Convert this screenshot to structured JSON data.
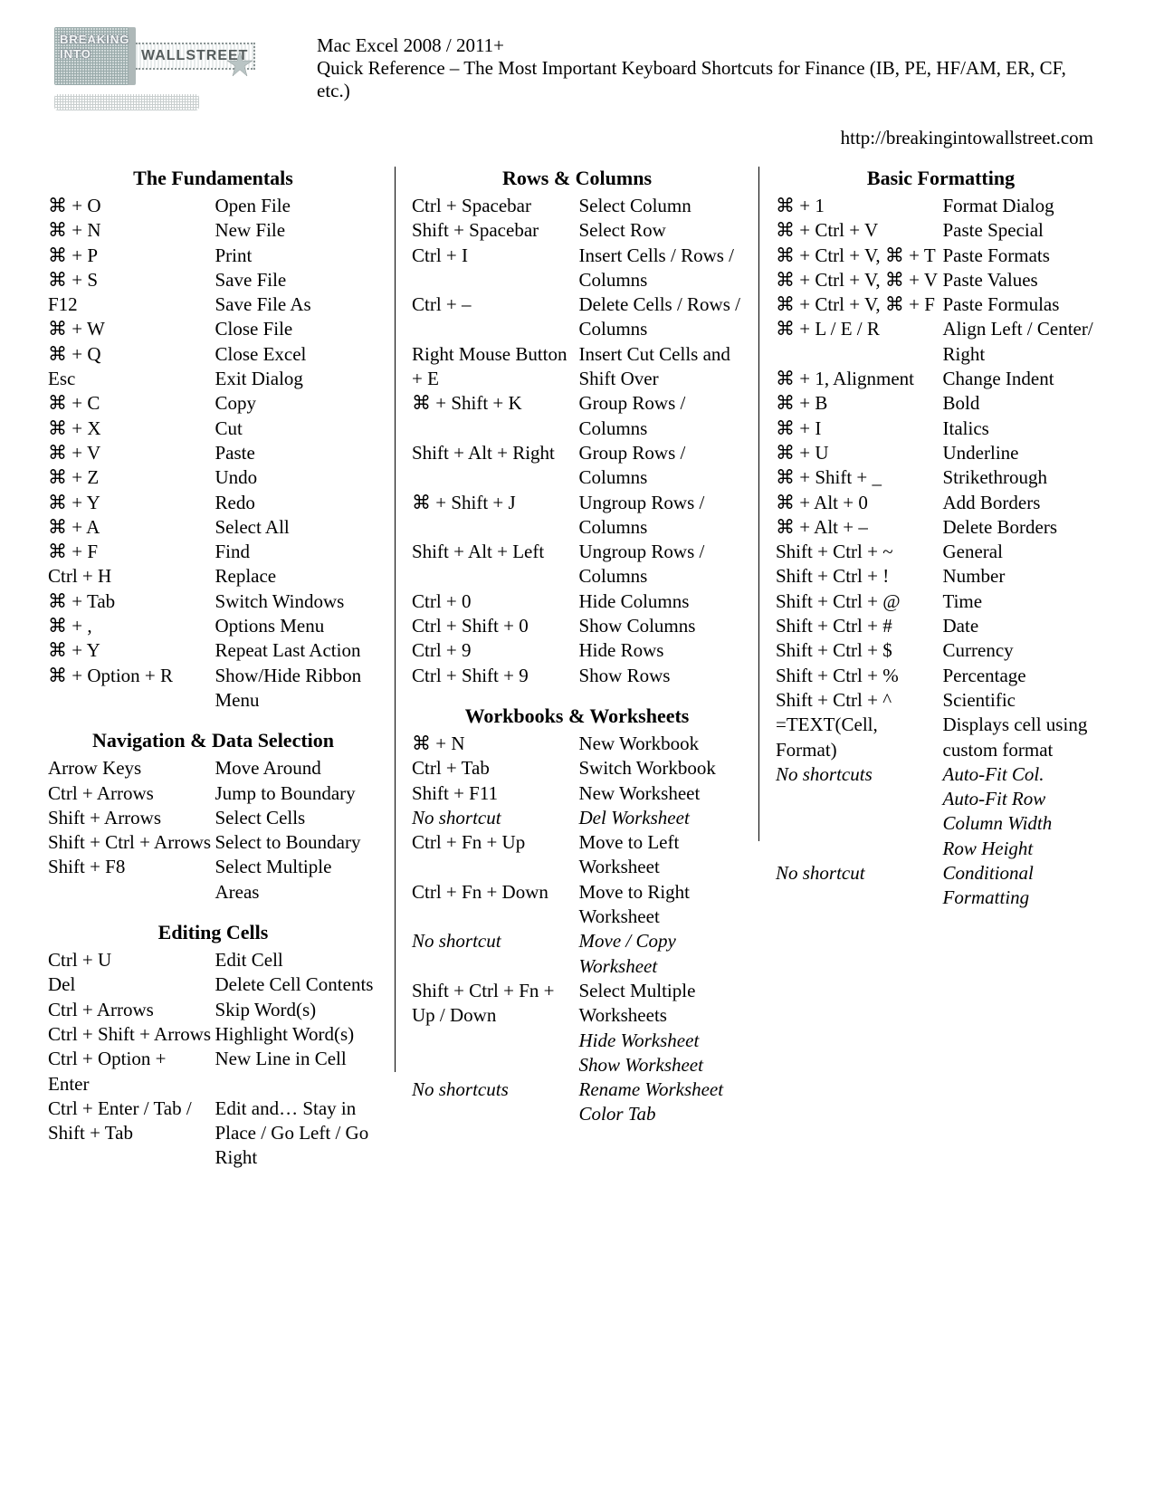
{
  "cmd_symbol": "⌘",
  "logo": {
    "word1": "BREAKING",
    "word2": "INTO",
    "word3": "WALLSTREET"
  },
  "header": {
    "line1": "Mac Excel 2008 / 2011+",
    "line2": "Quick Reference – The Most Important Keyboard Shortcuts for Finance (IB, PE, HF/AM, ER, CF, etc.)"
  },
  "url": "http://breakingintowallstreet.com",
  "columns": [
    {
      "sections": [
        {
          "title": "The Fundamentals",
          "rows": [
            {
              "k": "⌘ + O",
              "v": "Open File"
            },
            {
              "k": "⌘ + N",
              "v": "New File"
            },
            {
              "k": "⌘ + P",
              "v": "Print"
            },
            {
              "k": "⌘ + S",
              "v": "Save File"
            },
            {
              "k": "F12",
              "v": "Save File As"
            },
            {
              "k": "⌘ + W",
              "v": "Close File"
            },
            {
              "k": "⌘ + Q",
              "v": "Close Excel"
            },
            {
              "k": "Esc",
              "v": "Exit Dialog"
            },
            {
              "k": "⌘ + C",
              "v": "Copy"
            },
            {
              "k": "⌘ + X",
              "v": "Cut"
            },
            {
              "k": "⌘ + V",
              "v": "Paste"
            },
            {
              "k": "⌘ + Z",
              "v": "Undo"
            },
            {
              "k": "⌘ + Y",
              "v": "Redo"
            },
            {
              "k": "⌘ + A",
              "v": "Select All"
            },
            {
              "k": "⌘ + F",
              "v": "Find"
            },
            {
              "k": "Ctrl + H",
              "v": "Replace"
            },
            {
              "k": "⌘ + Tab",
              "v": "Switch Windows"
            },
            {
              "k": "⌘ + ,",
              "v": "Options Menu"
            },
            {
              "k": "⌘ + Y",
              "v": "Repeat Last Action"
            },
            {
              "k": "⌘ + Option + R",
              "v": "Show/Hide Ribbon Menu"
            }
          ]
        },
        {
          "title": "Navigation & Data Selection",
          "rows": [
            {
              "k": "Arrow Keys",
              "v": "Move Around"
            },
            {
              "k": "Ctrl + Arrows",
              "v": "Jump to Boundary"
            },
            {
              "k": "Shift + Arrows",
              "v": "Select Cells"
            },
            {
              "k": "Shift + Ctrl + Arrows",
              "v": "Select to Boundary"
            },
            {
              "k": "Shift + F8",
              "v": "Select Multiple Areas"
            }
          ]
        },
        {
          "title": "Editing Cells",
          "rows": [
            {
              "k": "Ctrl + U",
              "v": "Edit Cell"
            },
            {
              "k": "Del",
              "v": "Delete Cell Contents"
            },
            {
              "k": "Ctrl + Arrows",
              "v": "Skip Word(s)"
            },
            {
              "k": "Ctrl + Shift + Arrows",
              "v": "Highlight Word(s)"
            },
            {
              "k": "Ctrl + Option + Enter",
              "v": "New Line in Cell"
            },
            {
              "k": "Ctrl + Enter / Tab / Shift + Tab",
              "v": "Edit and… Stay in Place / Go Left / Go Right"
            }
          ]
        }
      ]
    },
    {
      "sections": [
        {
          "title": "Rows & Columns",
          "rows": [
            {
              "k": "Ctrl + Spacebar",
              "v": "Select Column"
            },
            {
              "k": "Shift + Spacebar",
              "v": "Select Row"
            },
            {
              "k": "Ctrl + I",
              "v": "Insert Cells / Rows / Columns"
            },
            {
              "k": "Ctrl + –",
              "v": "Delete Cells / Rows / Columns"
            },
            {
              "k": "Right Mouse Button + E",
              "v": "Insert Cut Cells and Shift Over"
            },
            {
              "k": "⌘ + Shift + K",
              "v": "Group Rows / Columns"
            },
            {
              "k": "Shift + Alt + Right",
              "v": "Group Rows / Columns"
            },
            {
              "k": "⌘ + Shift + J",
              "v": "Ungroup Rows / Columns"
            },
            {
              "k": "Shift + Alt + Left",
              "v": "Ungroup Rows / Columns"
            },
            {
              "k": "Ctrl + 0",
              "v": "Hide Columns"
            },
            {
              "k": "Ctrl + Shift + 0",
              "v": "Show Columns"
            },
            {
              "k": "Ctrl + 9",
              "v": "Hide Rows"
            },
            {
              "k": "Ctrl + Shift + 9",
              "v": "Show Rows"
            }
          ]
        },
        {
          "title": "Workbooks & Worksheets",
          "rows": [
            {
              "k": "⌘ + N",
              "v": "New Workbook"
            },
            {
              "k": "Ctrl + Tab",
              "v": "Switch Workbook"
            },
            {
              "k": "Shift + F11",
              "v": "New Worksheet"
            },
            {
              "k": "No shortcut",
              "v": "Del Worksheet",
              "italic": true
            },
            {
              "k": "Ctrl + Fn + Up",
              "v": "Move to Left Worksheet"
            },
            {
              "k": "Ctrl + Fn + Down",
              "v": "Move to Right Worksheet"
            },
            {
              "k": "No shortcut",
              "v": "Move / Copy Worksheet",
              "italic": true
            },
            {
              "k": "Shift + Ctrl + Fn + Up / Down",
              "v": "Select Multiple Worksheets"
            },
            {
              "k": "",
              "v": "Hide Worksheet",
              "italic": true
            },
            {
              "k": "",
              "v": "Show Worksheet",
              "italic": true
            },
            {
              "k": "No shortcuts",
              "v": "Rename Worksheet",
              "italic": true
            },
            {
              "k": "",
              "v": "Color Tab",
              "italic": true
            }
          ]
        }
      ]
    },
    {
      "sections": [
        {
          "title": "Basic Formatting",
          "rows": [
            {
              "k": "⌘ + 1",
              "v": "Format Dialog"
            },
            {
              "k": "⌘ + Ctrl + V",
              "v": "Paste Special"
            },
            {
              "k": "⌘ + Ctrl + V, ⌘ + T",
              "v": "Paste Formats"
            },
            {
              "k": "⌘ + Ctrl + V, ⌘ + V",
              "v": "Paste Values"
            },
            {
              "k": "⌘ + Ctrl + V, ⌘ + F",
              "v": "Paste Formulas"
            },
            {
              "k": "⌘ + L / E / R",
              "v": "Align Left / Center/ Right"
            },
            {
              "k": "⌘ + 1, Alignment",
              "v": "Change Indent"
            },
            {
              "k": "⌘ + B",
              "v": "Bold"
            },
            {
              "k": "⌘ + I",
              "v": "Italics"
            },
            {
              "k": "⌘ + U",
              "v": "Underline"
            },
            {
              "k": "⌘ + Shift + _",
              "v": "Strikethrough"
            },
            {
              "k": "⌘ + Alt + 0",
              "v": "Add Borders"
            },
            {
              "k": "⌘ + Alt + –",
              "v": "Delete Borders"
            },
            {
              "k": "Shift + Ctrl + ~",
              "v": "General"
            },
            {
              "k": "Shift + Ctrl + !",
              "v": "Number"
            },
            {
              "k": "Shift + Ctrl + @",
              "v": "Time"
            },
            {
              "k": "Shift + Ctrl + #",
              "v": "Date"
            },
            {
              "k": "Shift + Ctrl + $",
              "v": "Currency"
            },
            {
              "k": "Shift + Ctrl + %",
              "v": "Percentage"
            },
            {
              "k": "Shift + Ctrl + ^",
              "v": "Scientific"
            },
            {
              "k": "=TEXT(Cell, Format)",
              "v": "Displays cell using custom format"
            },
            {
              "k": "No shortcuts",
              "v": "Auto-Fit Col.",
              "italic": true
            },
            {
              "k": "",
              "v": "Auto-Fit Row",
              "italic": true
            },
            {
              "k": "",
              "v": "Column Width",
              "italic": true
            },
            {
              "k": "",
              "v": "Row Height",
              "italic": true
            },
            {
              "k": "No shortcut",
              "v": "Conditional Formatting",
              "italic": true
            }
          ]
        }
      ]
    }
  ]
}
